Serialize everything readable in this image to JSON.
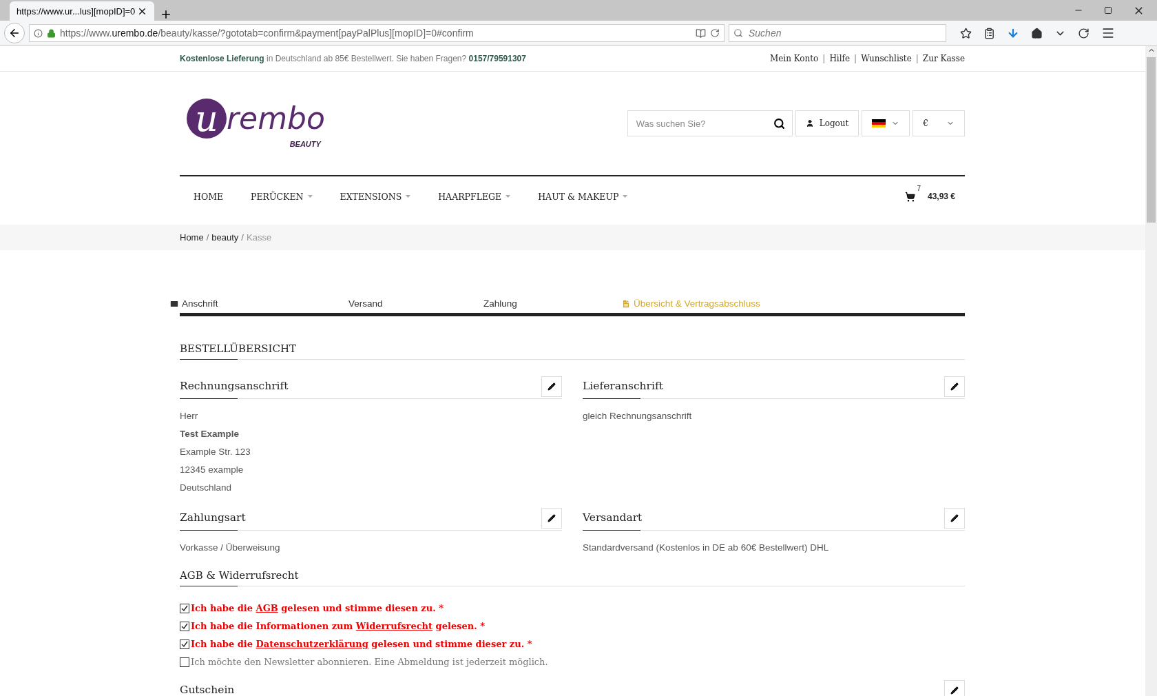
{
  "browser": {
    "tab": {
      "title": "https://www.ur...lus][mopID]=0",
      "selected": true
    },
    "url": {
      "prefix": "https://www.",
      "domain": "urembo.de",
      "path": "/beauty/kasse/?gototab=confirm&payment[payPalPlus][mopID]=0#confirm"
    },
    "search": {
      "placeholder": "Suchen"
    }
  },
  "topbar": {
    "highlight": "Kostenlose Lieferung",
    "text": " in Deutschland ab 85€ Bestellwert. Sie haben Fragen? ",
    "phone": "0157/79591307",
    "links": [
      {
        "label": "Mein Konto"
      },
      {
        "sep": "|",
        "label": "Hilfe"
      },
      {
        "sep": "|",
        "label": "Wunschliste"
      },
      {
        "sep": "|",
        "label": "Zur Kasse"
      }
    ]
  },
  "logo": {
    "initial": "u",
    "name": "rembo",
    "tagline": "BEAUTY"
  },
  "header": {
    "search_placeholder": "Was suchen Sie?",
    "logout": "Logout",
    "currency": "€"
  },
  "nav": [
    {
      "label": "HOME",
      "dropdown": false
    },
    {
      "label": "PERÜCKEN",
      "dropdown": true
    },
    {
      "label": "EXTENSIONS",
      "dropdown": true
    },
    {
      "label": "HAARPFLEGE",
      "dropdown": true
    },
    {
      "label": "HAUT & MAKEUP",
      "dropdown": true
    }
  ],
  "cart": {
    "count": "7",
    "total": "43,93 €"
  },
  "breadcrumb": [
    {
      "label": "Home",
      "current": false
    },
    {
      "sep": "/",
      "label": "beauty",
      "current": false
    },
    {
      "sep": "/",
      "label": "Kasse",
      "current": true
    }
  ],
  "steps": [
    {
      "label": "Anschrift",
      "kind": "address",
      "selected": false
    },
    {
      "label": "Versand",
      "kind": "shipping",
      "selected": false
    },
    {
      "label": "Zahlung",
      "kind": "payment",
      "selected": false
    },
    {
      "label": "Übersicht & Vertragsabschluss",
      "kind": "overview",
      "selected": true
    }
  ],
  "title": "BESTELLÜBERSICHT",
  "panels": [
    {
      "title": "Rechnungsanschrift",
      "lines": [
        {
          "text": "Herr",
          "bold": false
        },
        {
          "text": "Test Example",
          "bold": true
        },
        {
          "text": "Example Str. 123",
          "bold": false
        },
        {
          "text": "12345 example",
          "bold": false
        },
        {
          "text": "Deutschland",
          "bold": false
        }
      ]
    },
    {
      "title": "Lieferanschrift",
      "lines": [
        {
          "text": "gleich Rechnungsanschrift",
          "bold": false
        }
      ]
    },
    {
      "title": "Zahlungsart",
      "lines": [
        {
          "text": "Vorkasse / Überweisung",
          "bold": false
        }
      ]
    },
    {
      "title": "Versandart",
      "lines": [
        {
          "text": "Standardversand (Kostenlos in DE ab 60€ Bestellwert) DHL",
          "bold": false
        }
      ]
    }
  ],
  "agb": {
    "title": "AGB & Widerrufsrecht",
    "items": [
      {
        "before": "Ich habe die ",
        "link": "AGB",
        "after": " gelesen und stimme diesen zu. *",
        "checked": true,
        "required": true
      },
      {
        "before": "Ich habe die Informationen zum ",
        "link": "Widerrufsrecht",
        "after": " gelesen. *",
        "checked": true,
        "required": true
      },
      {
        "before": "Ich habe die ",
        "link": "Datenschutzerklärung",
        "after": " gelesen und stimme dieser zu. *",
        "checked": true,
        "required": true
      },
      {
        "before": "Ich möchte den Newsletter abonnieren. Eine Abmeldung ist jederzeit möglich.",
        "checked": false,
        "required": false
      }
    ]
  },
  "voucher": {
    "title": "Gutschein"
  }
}
